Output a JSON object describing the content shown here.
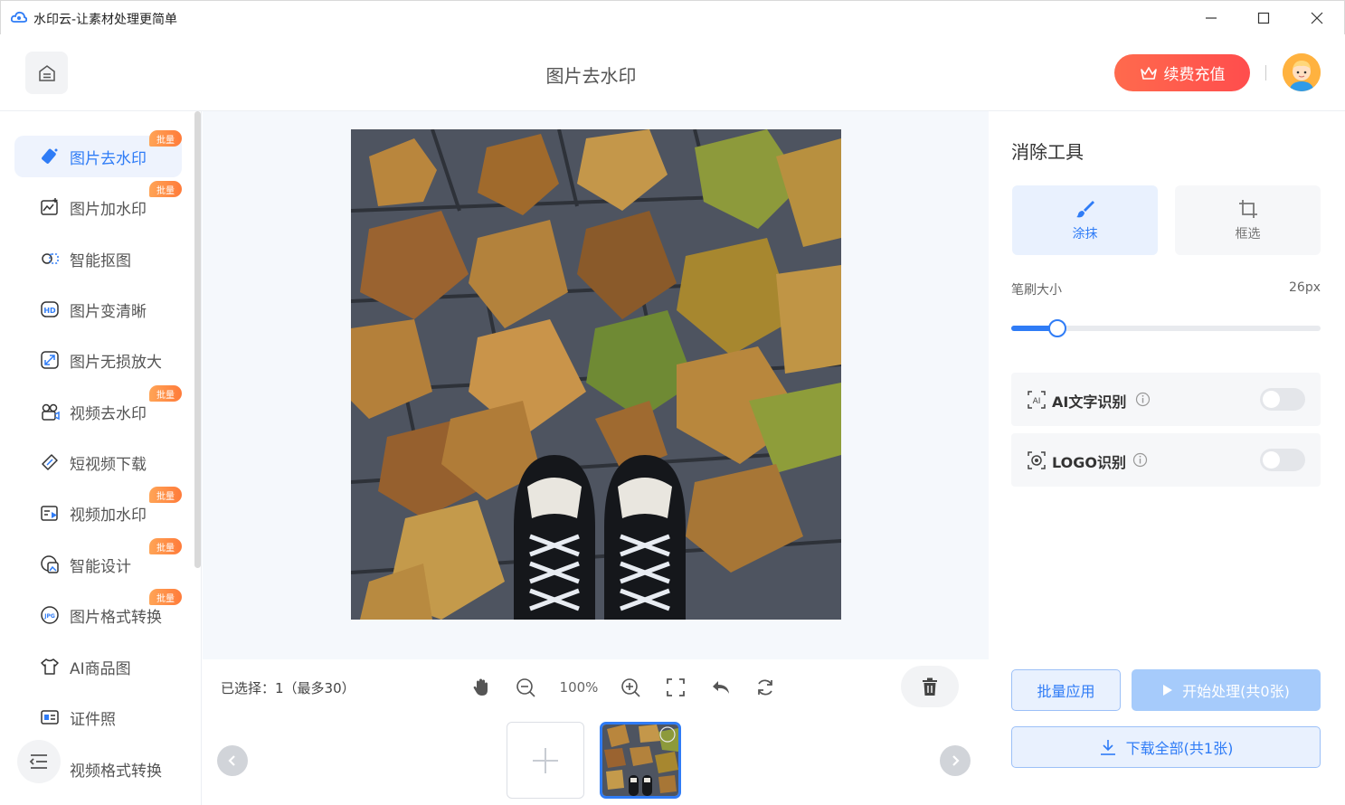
{
  "window": {
    "title": "水印云-让素材处理更简单"
  },
  "header": {
    "page_title": "图片去水印",
    "renew_label": "续费充值"
  },
  "sidebar": {
    "badge_label": "批量",
    "items": [
      {
        "label": "图片去水印",
        "icon": "eraser-icon",
        "active": true,
        "badge": true
      },
      {
        "label": "图片加水印",
        "icon": "image-add-icon",
        "active": false,
        "badge": true
      },
      {
        "label": "智能抠图",
        "icon": "cutout-icon",
        "active": false,
        "badge": false
      },
      {
        "label": "图片变清晰",
        "icon": "hd-icon",
        "active": false,
        "badge": false
      },
      {
        "label": "图片无损放大",
        "icon": "enlarge-icon",
        "active": false,
        "badge": false
      },
      {
        "label": "视频去水印",
        "icon": "video-eraser-icon",
        "active": false,
        "badge": true
      },
      {
        "label": "短视频下载",
        "icon": "link-icon",
        "active": false,
        "badge": false
      },
      {
        "label": "视频加水印",
        "icon": "video-add-icon",
        "active": false,
        "badge": true
      },
      {
        "label": "智能设计",
        "icon": "design-icon",
        "active": false,
        "badge": true
      },
      {
        "label": "图片格式转换",
        "icon": "jpg-icon",
        "active": false,
        "badge": true
      },
      {
        "label": "AI商品图",
        "icon": "shirt-icon",
        "active": false,
        "badge": false
      },
      {
        "label": "证件照",
        "icon": "id-card-icon",
        "active": false,
        "badge": false
      },
      {
        "label": "视频格式转换",
        "icon": "video-convert-icon",
        "active": false,
        "badge": false
      }
    ]
  },
  "toolbar": {
    "selection_info": "已选择：1（最多30）",
    "zoom_level": "100%"
  },
  "panel": {
    "title": "消除工具",
    "modes": [
      {
        "label": "涂抹",
        "active": true
      },
      {
        "label": "框选",
        "active": false
      }
    ],
    "brush_label": "笔刷大小",
    "brush_value": "26px",
    "brush_fraction": 0.15,
    "ai_text_label": "AI文字识别",
    "ai_text_on": false,
    "logo_label": "LOGO识别",
    "logo_on": false,
    "batch_label": "批量应用",
    "start_label": "开始处理(共0张)",
    "download_label": "下载全部(共1张)"
  },
  "colors": {
    "accent": "#2f7cf6",
    "renew_gradient_start": "#ff6a4d",
    "badge": "#ff8a42"
  }
}
